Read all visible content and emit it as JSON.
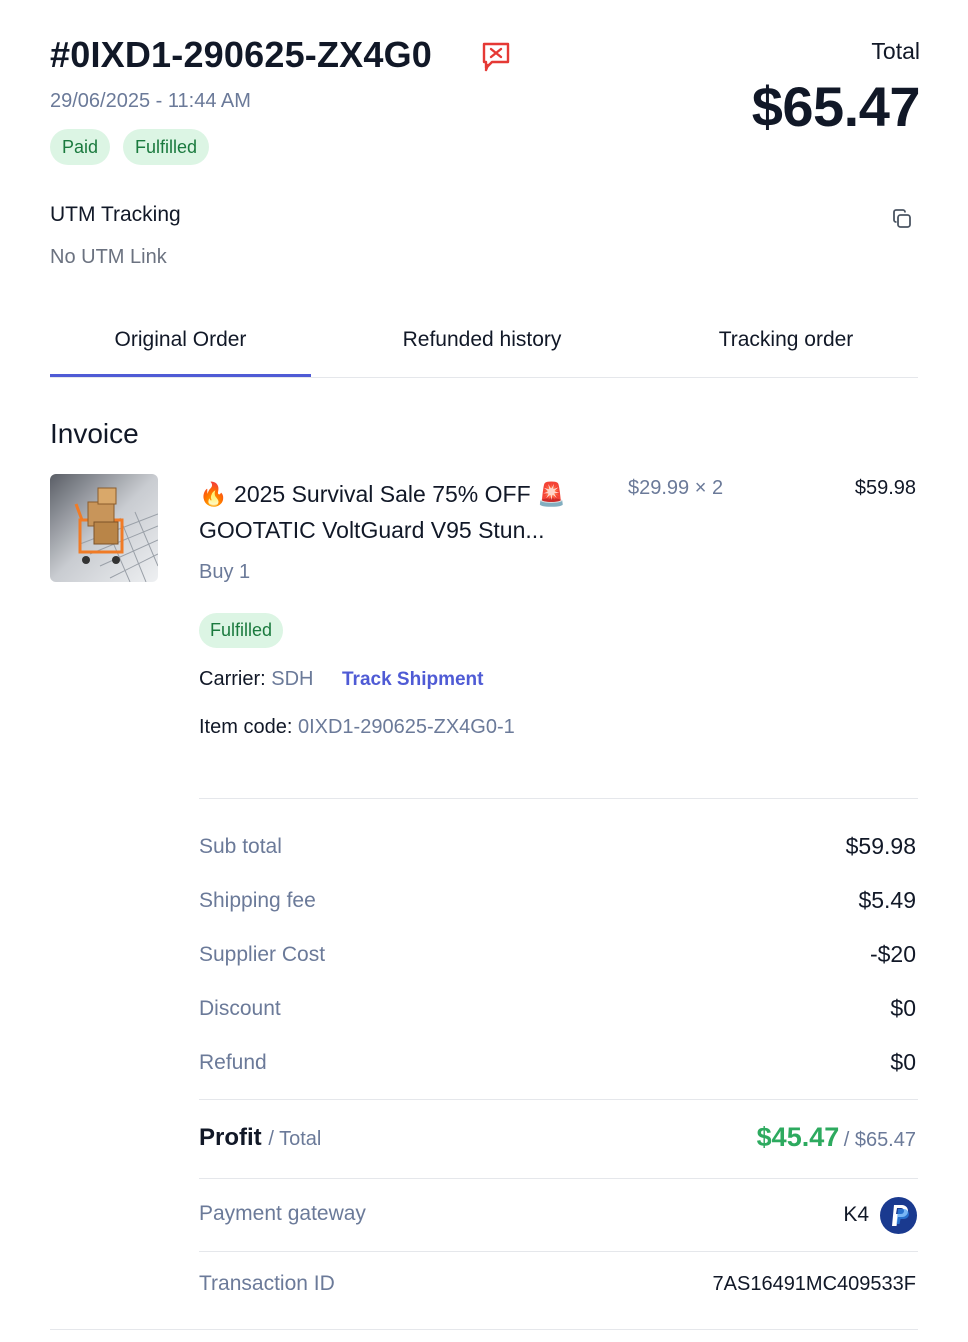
{
  "order": {
    "id": "#0IXD1-290625-ZX4G0",
    "date": "29/06/2025 - 11:44 AM",
    "total_label": "Total",
    "total_value": "$65.47",
    "badges": [
      "Paid",
      "Fulfilled"
    ]
  },
  "utm": {
    "title": "UTM Tracking",
    "value": "No UTM Link"
  },
  "tabs": [
    {
      "label": "Original Order",
      "active": true
    },
    {
      "label": "Refunded history",
      "active": false
    },
    {
      "label": "Tracking order",
      "active": false
    }
  ],
  "invoice": {
    "title": "Invoice",
    "item": {
      "title_line1": "🔥 2025 Survival Sale 75% OFF 🚨",
      "title_line2": "GOOTATIC VoltGuard V95 Stun...",
      "unit_price": "$29.99 × 2",
      "line_total": "$59.98",
      "buy_qty": "Buy 1",
      "status": "Fulfilled",
      "carrier_label": "Carrier:",
      "carrier_value": "SDH",
      "track_label": "Track Shipment",
      "item_code_label": "Item code:",
      "item_code_value": "0IXD1-290625-ZX4G0-1"
    }
  },
  "summary": {
    "rows": [
      {
        "label": "Sub total",
        "value": "$59.98"
      },
      {
        "label": "Shipping fee",
        "value": "$5.49"
      },
      {
        "label": "Supplier Cost",
        "value": "-$20"
      },
      {
        "label": "Discount",
        "value": "$0"
      },
      {
        "label": "Refund",
        "value": "$0"
      }
    ],
    "profit_label": "Profit",
    "profit_total_label": "/ Total",
    "profit_value": "$45.47",
    "profit_total_value": "/ $65.47",
    "gateway_label": "Payment gateway",
    "gateway_code": "K4",
    "transaction_label": "Transaction ID",
    "transaction_value": "7AS16491MC409533F"
  },
  "colors": {
    "accent": "#4f5bd5",
    "profit_green": "#2daa5f",
    "badge_bg": "#dcf5e4",
    "badge_text": "#1a7a3e",
    "alert_red": "#e53935"
  },
  "icons": [
    "flag-report-icon",
    "copy-icon",
    "paypal-icon"
  ]
}
